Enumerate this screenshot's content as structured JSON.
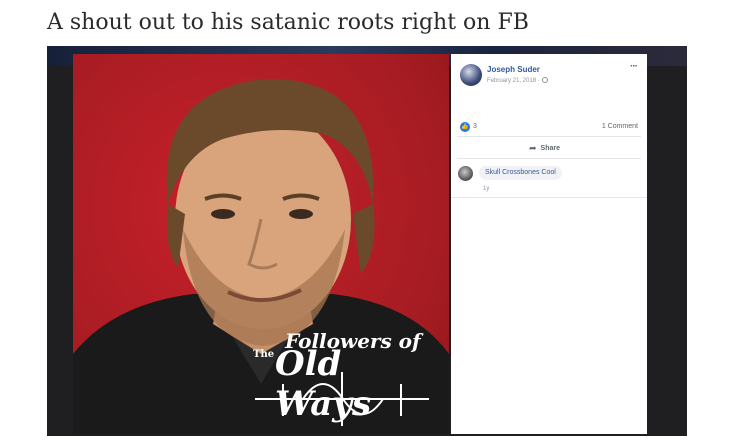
{
  "headline": "A shout out to his satanic roots right on FB",
  "post": {
    "author": "Joseph Suder",
    "date": "February 21, 2018 ·",
    "privacy_icon": "globe-icon",
    "more_label": "···",
    "likes": "3",
    "comments": "1 Comment",
    "share_label": "Share"
  },
  "photo": {
    "logo_prefix": "The",
    "logo_line1": "Followers of",
    "logo_line2": "Old Ways"
  },
  "comment": {
    "name": "Skull Crossbones Cool",
    "time": "1y"
  },
  "colors": {
    "fb_blue": "#385898",
    "like_blue": "#2078f4",
    "photo_red": "#a51c22"
  }
}
